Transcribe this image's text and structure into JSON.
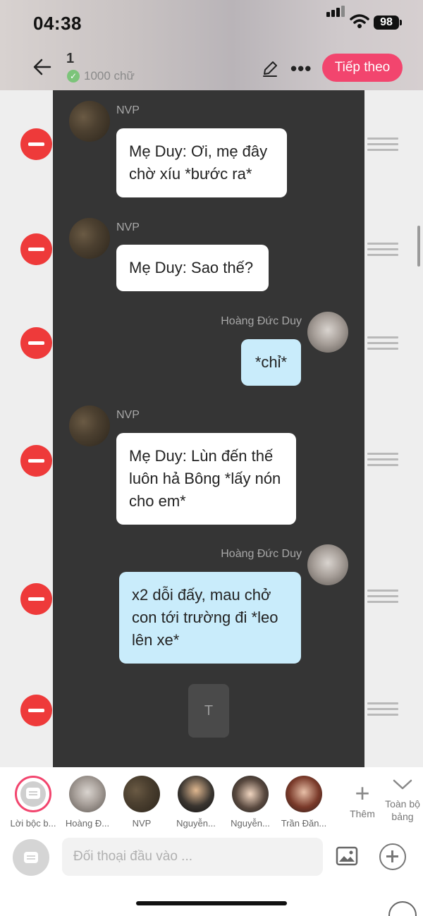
{
  "status_bar": {
    "time": "04:38",
    "battery": "98"
  },
  "header": {
    "chapter_number": "1",
    "word_count": "1000 chữ",
    "next_label": "Tiếp theo"
  },
  "messages": [
    {
      "speaker": "NVP",
      "side": "left",
      "text": "Mẹ Duy: Ơi, mẹ đây chờ xíu *bước ra*"
    },
    {
      "speaker": "NVP",
      "side": "left",
      "text": "Mẹ Duy: Sao thế?"
    },
    {
      "speaker": "Hoàng Đức Duy",
      "side": "right",
      "text": "*chỉ*"
    },
    {
      "speaker": "NVP",
      "side": "left",
      "text": "Mẹ Duy: Lùn đến thế luôn hả Bông *lấy nón cho em*"
    },
    {
      "speaker": "Hoàng Đức Duy",
      "side": "right",
      "text": "x2 dỗi đấy, mau chở con tới trường đi *leo lên xe*"
    }
  ],
  "typing_placeholder": "T",
  "characters": [
    {
      "label": "Lời bộc b..."
    },
    {
      "label": "Hoàng Đ..."
    },
    {
      "label": "NVP"
    },
    {
      "label": "Nguyễn..."
    },
    {
      "label": "Nguyễn..."
    },
    {
      "label": "Trần Đăn..."
    }
  ],
  "add_more_label": "Thêm",
  "full_table_label": "Toàn bộ bảng",
  "input": {
    "placeholder": "Đối thoại đầu vào ..."
  },
  "colors": {
    "accent": "#f2456e",
    "delete": "#ee3a3a",
    "chat_bg": "#353535",
    "bubble_blue": "#c9ecfb"
  }
}
